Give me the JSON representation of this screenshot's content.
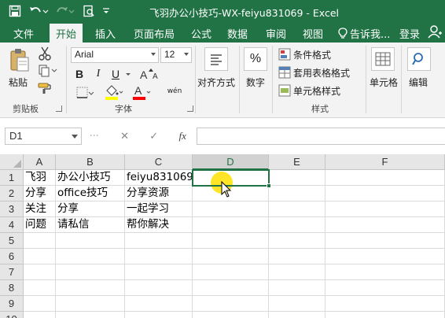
{
  "window": {
    "title": "飞羽办公小技巧-WX-feiyu831069 - Excel"
  },
  "ribbon_tabs": [
    "文件",
    "开始",
    "插入",
    "页面布局",
    "公式",
    "数据",
    "审阅",
    "视图"
  ],
  "active_tab": "开始",
  "tell_me": "告诉我...",
  "sign_in": "登录",
  "clipboard": {
    "paste_label": "粘贴",
    "group_label": "剪贴板"
  },
  "font": {
    "name": "Arial",
    "size": "12",
    "bold": "B",
    "italic": "I",
    "underline": "U",
    "phonetic": "wén",
    "group_label": "字体",
    "fill_color": "#ffff00",
    "font_color": "#ff0000"
  },
  "alignment": {
    "label": "对齐方式"
  },
  "number": {
    "label": "数字",
    "symbol": "%"
  },
  "styles": {
    "conditional": "条件格式",
    "table": "套用表格格式",
    "cell_styles": "单元格样式",
    "group_label": "样式"
  },
  "cells_group": {
    "label": "单元格"
  },
  "editing": {
    "label": "编辑"
  },
  "formula_bar": {
    "name_box": "D1",
    "fx": "fx",
    "cancel": "✕",
    "enter": "✓",
    "content": ""
  },
  "columns": [
    "A",
    "B",
    "C",
    "D",
    "E",
    "F"
  ],
  "selected_column": "D",
  "rows": [
    "1",
    "2",
    "3",
    "4",
    "5",
    "6",
    "7",
    "8",
    "9",
    "10"
  ],
  "cells": {
    "A1": "飞羽",
    "B1": "办公小技巧",
    "C1": "feiyu831069",
    "A2": "分享",
    "B2": "office技巧",
    "C2": "分享资源",
    "A3": "关注",
    "B3": "分享",
    "C3": "一起学习",
    "A4": "问题",
    "B4": "请私信",
    "C4": "帮你解决"
  },
  "accent_color": "#217346"
}
